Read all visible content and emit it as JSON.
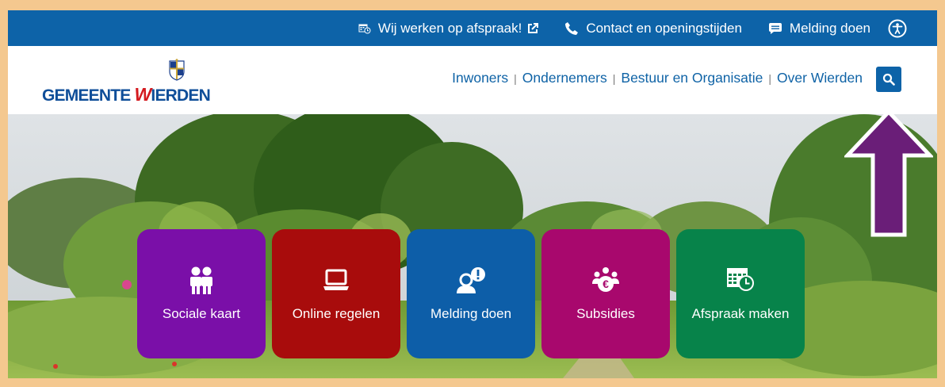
{
  "topbar": {
    "appointment_label": "Wij werken op afspraak!",
    "contact_label": "Contact en openingstijden",
    "report_label": "Melding doen",
    "accessibility_icon": "accessibility-icon"
  },
  "header": {
    "logo_text_part1": "GEMEENTE ",
    "logo_text_w": "W",
    "logo_text_part2": "IERDEN",
    "nav": [
      "Inwoners",
      "Ondernemers",
      "Bestuur en Organisatie",
      "Over Wierden"
    ],
    "search_icon": "search-icon"
  },
  "tiles": [
    {
      "label": "Sociale kaart",
      "color": "#7a0fa8",
      "icon": "people-icon"
    },
    {
      "label": "Online regelen",
      "color": "#a80c0c",
      "icon": "laptop-icon"
    },
    {
      "label": "Melding doen",
      "color": "#0d5ea8",
      "icon": "person-alert-icon"
    },
    {
      "label": "Subsidies",
      "color": "#a8086d",
      "icon": "group-euro-icon"
    },
    {
      "label": "Afspraak maken",
      "color": "#07834a",
      "icon": "calendar-clock-icon"
    }
  ],
  "colors": {
    "brand_blue": "#0d63a8",
    "frame_border": "#f4c88f",
    "annotation_arrow": "#6a1e78"
  }
}
